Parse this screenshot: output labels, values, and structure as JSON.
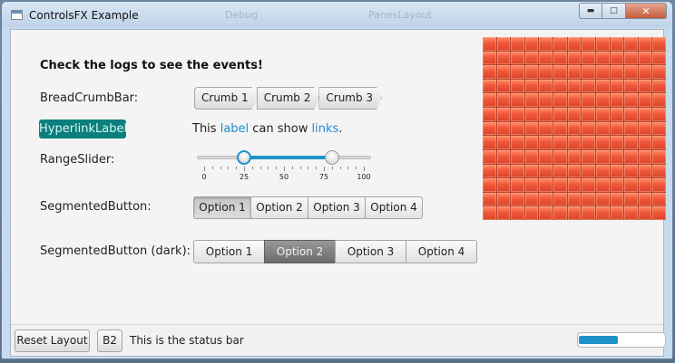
{
  "window": {
    "title": "ControlsFX Example",
    "background_hint": [
      "Debug",
      "PanesLayout"
    ]
  },
  "heading": "Check the logs to see the events!",
  "breadcrumb": {
    "label": "BreadCrumbBar:",
    "items": [
      "Crumb 1",
      "Crumb 2",
      "Crumb 3"
    ]
  },
  "hyperlink": {
    "control_label": "HyperlinkLabel",
    "text_before": "This ",
    "link1": "label",
    "text_middle": " can show ",
    "link2": "links",
    "text_after": "."
  },
  "range_slider": {
    "label": "RangeSlider:",
    "min": 0,
    "max": 100,
    "low_value": 25,
    "high_value": 80,
    "tick_labels": [
      "0",
      "25",
      "50",
      "75",
      "100"
    ]
  },
  "segmented": {
    "label": "SegmentedButton:",
    "options": [
      "Option 1",
      "Option 2",
      "Option 3",
      "Option 4"
    ],
    "selected_index": 0
  },
  "segmented_dark": {
    "label": "SegmentedButton (dark):",
    "options": [
      "Option 1",
      "Option 2",
      "Option 3",
      "Option 4"
    ],
    "selected_index": 1
  },
  "mosaic": {
    "rows": 13,
    "cols": 13,
    "color": "#f1583a"
  },
  "statusbar": {
    "reset_button": "Reset Layout",
    "b2_button": "B2",
    "status_text": "This is the status bar",
    "progress": 0.45,
    "accent": "#1e92c9"
  }
}
